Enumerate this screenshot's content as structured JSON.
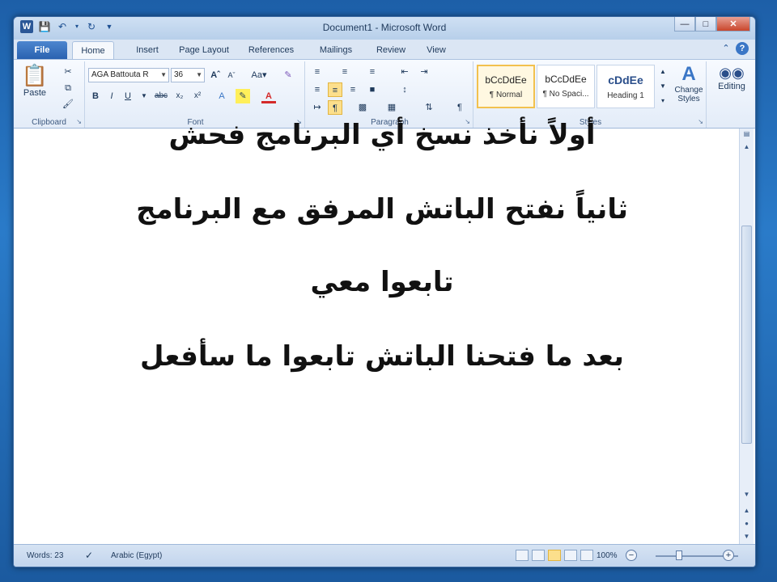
{
  "window": {
    "title": "Document1 - Microsoft Word"
  },
  "qat": {
    "app_icon": "W"
  },
  "tabs": [
    "File",
    "Home",
    "Insert",
    "Page Layout",
    "References",
    "Mailings",
    "Review",
    "View"
  ],
  "clipboard": {
    "paste_label": "Paste",
    "group_label": "Clipboard"
  },
  "font": {
    "name": "AGA Battouta R",
    "size": "36",
    "group_label": "Font"
  },
  "paragraph": {
    "group_label": "Paragraph"
  },
  "styles": {
    "items": [
      {
        "sample": "bCcDdEe",
        "name": "¶ Normal"
      },
      {
        "sample": "bCcDdEe",
        "name": "¶ No Spaci..."
      },
      {
        "sample": "cDdEe",
        "name": "Heading 1"
      }
    ],
    "change_label": "Change Styles",
    "group_label": "Styles"
  },
  "editing": {
    "label": "Editing"
  },
  "document": {
    "lines": [
      "أولاً نأخذ نسخ أي البرنامج فحش",
      "ثانياً نفتح الباتش المرفق مع البرنامج",
      "تابعوا معي",
      "بعد ما فتحنا الباتش تابعوا ما سأفعل"
    ]
  },
  "status": {
    "words": "Words: 23",
    "language": "Arabic (Egypt)",
    "zoom": "100%"
  }
}
